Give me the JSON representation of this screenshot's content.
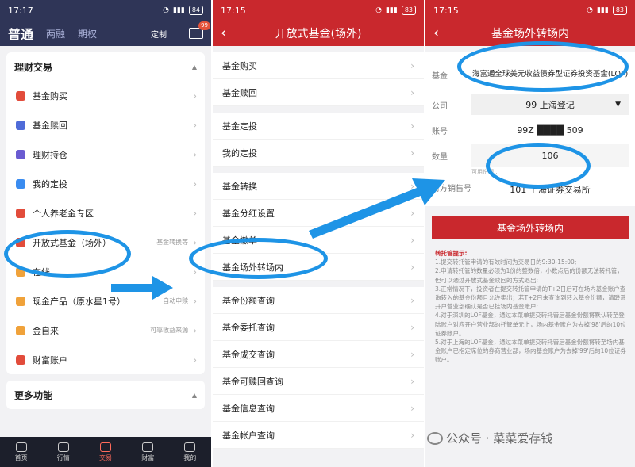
{
  "screen1": {
    "time": "17:17",
    "battery": "84",
    "tabs": [
      "普通",
      "两融",
      "期权"
    ],
    "custom_label": "定制",
    "msg_badge": "99",
    "section_title": "理财交易",
    "items": [
      {
        "label": "基金购买",
        "note": "",
        "color": "#e24c3b"
      },
      {
        "label": "基金赎回",
        "note": "",
        "color": "#4f6bd8"
      },
      {
        "label": "理财持仓",
        "note": "",
        "color": "#6a5bd1"
      },
      {
        "label": "我的定投",
        "note": "",
        "color": "#3a8cf0"
      },
      {
        "label": "个人养老金专区",
        "note": "",
        "color": "#e24c3b"
      },
      {
        "label": "开放式基金（场外）",
        "note": "基金转换等",
        "color": "#e24c3b"
      },
      {
        "label": "在线...",
        "note": "",
        "color": "#f0a23a"
      },
      {
        "label": "现金产品（原水星1号）",
        "note": "自动申赎",
        "color": "#f0a23a"
      },
      {
        "label": "金自来",
        "note": "可靠收益来源",
        "color": "#f0a23a"
      },
      {
        "label": "财富账户",
        "note": "",
        "color": "#e24c3b"
      }
    ],
    "more_title": "更多功能",
    "nav": [
      "首页",
      "行情",
      "交易",
      "财富",
      "我的"
    ]
  },
  "screen2": {
    "time": "17:15",
    "battery": "83",
    "title": "开放式基金(场外)",
    "group1": [
      "基金购买",
      "基金赎回"
    ],
    "group2": [
      "基金定投",
      "我的定投"
    ],
    "group3": [
      "基金转换",
      "基金分红设置",
      "基金撤单",
      "基金场外转场内"
    ],
    "group4": [
      "基金份额查询",
      "基金委托查询",
      "基金成交查询",
      "基金可赎回查询",
      "基金信息查询",
      "基金帐户查询"
    ]
  },
  "screen3": {
    "time": "17:15",
    "battery": "83",
    "title": "基金场外转场内",
    "fund_label": "基金",
    "fund_value": "海富通全球美元收益债券型证券投资基金(LOF)",
    "company_label": "公司",
    "company_value": "99 上海登记",
    "account_label": "账号",
    "account_value": "99Z ████ 509",
    "qty_label": "数量",
    "qty_value": "106",
    "avail_hint": "可用份额...",
    "counter_label": "对方销售号",
    "counter_value": "101 上海证券交易所",
    "submit_label": "基金场外转场内",
    "tips_title": "转托管提示:",
    "tips": [
      "1.提交转托管申请的有效时间为交易日的9:30-15:00;",
      "2.申请转托管的数量必须为1份的整数倍，小数点后的份额无法转托管，但可以通过开放式基金赎回的方式退出;",
      "3.正常情况下，投资者在提交转托管申请的T+2日后可在场内基金账户查询转入的基金份额且允许卖出；若T+2日未查询到转入基金份额，请联系开户营业部确认是否已挂场内基金账户;",
      "4.对于深圳的LOF基金，通过本菜单提交转托管后基金份额将默认转至登陆账户对应开户营业部的托管单元上，场内基金账户为去掉'98'后的10位证券账户。",
      "5.对于上海的LOF基金，通过本菜单提交转托管后基金份额将转至场内基金账户已指定席位的券商营业部，场内基金账户为去掉'99'后的10位证券账户。"
    ]
  },
  "watermark": "公众号 · 菜菜爱存钱",
  "colors": {
    "accent_red": "#c9282d",
    "navy": "#2f3557",
    "annotation_blue": "#1e94e6"
  }
}
